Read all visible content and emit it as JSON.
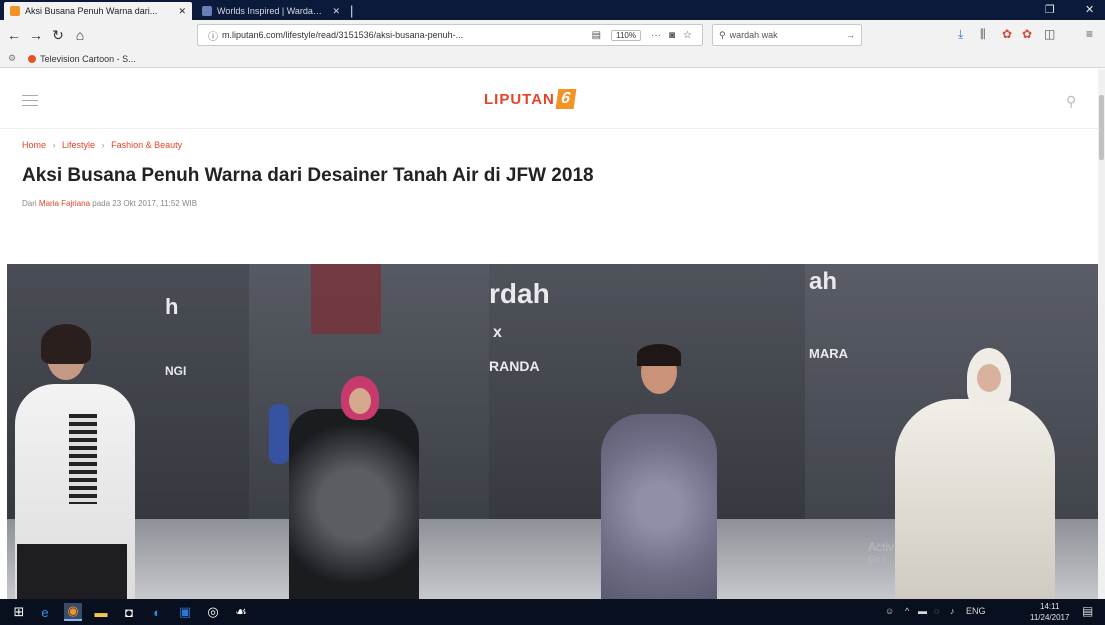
{
  "browser": {
    "tabs": [
      {
        "title": "Aksi Busana Penuh Warna dari...",
        "favicon_color": "#f39325",
        "active": true
      },
      {
        "title": "Worlds Inspired | Wardah Bea...",
        "favicon_color": "#6a7fb8",
        "active": false
      }
    ],
    "url": "m.liputan6.com/lifestyle/read/3151536/aksi-busana-penuh-...",
    "zoom": "110%",
    "search_placeholder": "wardah wak",
    "bookmark": "Television Cartoon - S..."
  },
  "site": {
    "logo_text": "LIPUTAN",
    "logo_number": "6",
    "brand_color": "#e44529",
    "accent_color": "#f39325"
  },
  "article": {
    "breadcrumbs": [
      "Home",
      "Lifestyle",
      "Fashion & Beauty"
    ],
    "title": "Aksi Busana Penuh Warna dari Desainer Tanah Air di JFW 2018",
    "byline_prefix": "Dari",
    "author": "Maria Fajriana",
    "byline_suffix": "pada 23 Okt 2017, 11:52 WIB"
  },
  "gallery": {
    "captions": [
      "h",
      "NGI",
      "rdah",
      "x",
      "RANDA",
      "ah",
      "MARA"
    ],
    "watermark": "Activ",
    "watermark_sub": "Go t"
  },
  "taskbar": {
    "tray_lang": "ENG",
    "time": "14:11",
    "date": "11/24/2017"
  }
}
